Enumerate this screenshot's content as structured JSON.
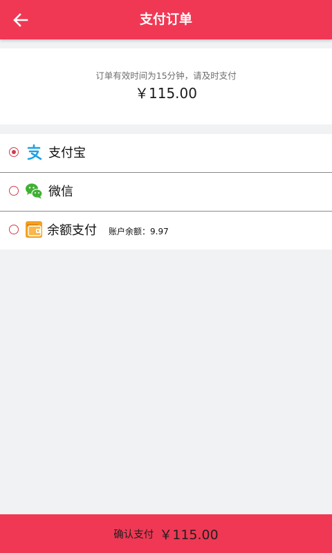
{
  "header": {
    "title": "支付订单",
    "back_icon": "arrow-left-icon"
  },
  "order": {
    "tip": "订单有效时间为15分钟，请及时支付",
    "amount": "￥115.00"
  },
  "payment_methods": [
    {
      "label": "支付宝",
      "icon": "alipay-icon",
      "selected": true
    },
    {
      "label": "微信",
      "icon": "wechat-icon",
      "selected": false
    },
    {
      "label": "余额支付",
      "icon": "wallet-icon",
      "selected": false,
      "note": "账户余额：9.97"
    }
  ],
  "footer": {
    "confirm_label": "确认支付",
    "confirm_amount": "￥115.00"
  },
  "colors": {
    "primary": "#f03854",
    "radio": "#d03a52",
    "alipay": "#1aa1e6",
    "wechat": "#41b035",
    "wallet": "#f5a020",
    "background": "#f1f2f4"
  }
}
